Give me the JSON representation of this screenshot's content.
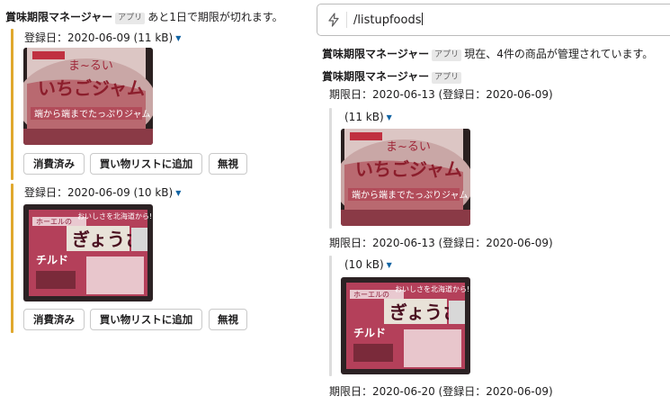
{
  "app": {
    "name": "賞味期限マネージャー",
    "badge": "アプリ"
  },
  "left": {
    "header_message": "あと1日で期限が切れます。",
    "items": [
      {
        "registered": "登録日：2020-06-09 (11 kB)",
        "image_icon": "jam-photo-icon",
        "buttons": [
          "消費済み",
          "買い物リストに追加",
          "無視"
        ]
      },
      {
        "registered": "登録日：2020-06-09 (10 kB)",
        "image_icon": "gyoza-photo-icon",
        "buttons": [
          "消費済み",
          "買い物リストに追加",
          "無視"
        ]
      }
    ]
  },
  "composer": {
    "command": "/listupfoods",
    "icon": "lightning-bolt-icon"
  },
  "right": {
    "summary": "現在、4件の商品が管理されています。",
    "entries": [
      {
        "deadline": "期限日：2020-06-13 (登録日：2020-06-09)",
        "size": "(11 kB)",
        "image_icon": "jam-photo-icon"
      },
      {
        "deadline": "期限日：2020-06-13 (登録日：2020-06-09)",
        "size": "(10 kB)",
        "image_icon": "gyoza-photo-icon"
      },
      {
        "deadline": "期限日：2020-06-20 (登録日：2020-06-09)"
      }
    ]
  },
  "colors": {
    "accent_bar": "#e0a82e",
    "link_blue": "#1264a3"
  }
}
